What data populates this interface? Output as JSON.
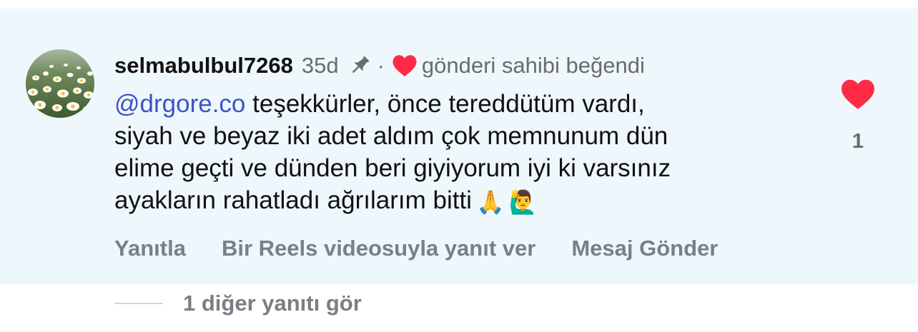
{
  "comment": {
    "username": "selmabulbul7268",
    "time": "35d",
    "separator": "·",
    "liked_by_author_text": "gönderi sahibi beğendi",
    "mention": "@drgore.co",
    "lines": [
      " teşekkürler, önce tereddütüm vardı,",
      "siyah ve beyaz iki adet aldım çok memnunum dün",
      "elime geçti ve dünden beri giyiyorum iyi ki varsınız",
      "ayakların rahatladı ağrılarım bitti"
    ],
    "emojis": [
      "🙏",
      "🙋‍♂️"
    ],
    "like_count": "1",
    "accent_colors": {
      "heart": "#ff2a46",
      "mention": "#3d52c9",
      "background": "#eef7fb"
    },
    "icons": [
      "avatar-photo-daisies",
      "pin-icon",
      "heart-filled-icon"
    ]
  },
  "actions": {
    "reply": "Yanıtla",
    "reels_reply": "Bir Reels videosuyla yanıt ver",
    "send_message": "Mesaj Gönder"
  },
  "replies": {
    "view_more": "1 diğer yanıtı gör"
  }
}
